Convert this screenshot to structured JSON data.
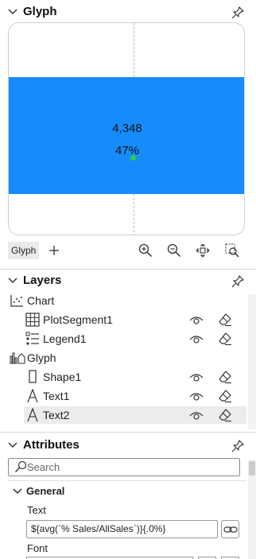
{
  "glyph_panel": {
    "title": "Glyph",
    "values": {
      "number": "4,348",
      "percent": "47%"
    },
    "toolbar": {
      "glyph_tab": "Glyph",
      "add_icon": "plus-icon",
      "zoom_in_icon": "zoom-in-icon",
      "zoom_out_icon": "zoom-out-icon",
      "fit_icon": "fit-view-icon",
      "zoom_area_icon": "zoom-area-icon"
    },
    "colors": {
      "shape_fill": "#168cfb",
      "anchor": "#2ecc40"
    }
  },
  "layers_panel": {
    "title": "Layers",
    "items": [
      {
        "label": "Chart",
        "icon": "chart-icon"
      },
      {
        "label": "PlotSegment1",
        "icon": "grid-icon"
      },
      {
        "label": "Legend1",
        "icon": "legend-icon"
      },
      {
        "label": "Glyph",
        "icon": "glyph-icon"
      },
      {
        "label": "Shape1",
        "icon": "rectangle-icon"
      },
      {
        "label": "Text1",
        "icon": "text-icon"
      },
      {
        "label": "Text2",
        "icon": "text-icon"
      }
    ],
    "selected": "Text2"
  },
  "attributes_panel": {
    "title": "Attributes",
    "search_placeholder": "Search",
    "section": "General",
    "text_label": "Text",
    "text_value": "${avg(`% Sales/AllSales`)}{.0%}",
    "font_label": "Font"
  }
}
